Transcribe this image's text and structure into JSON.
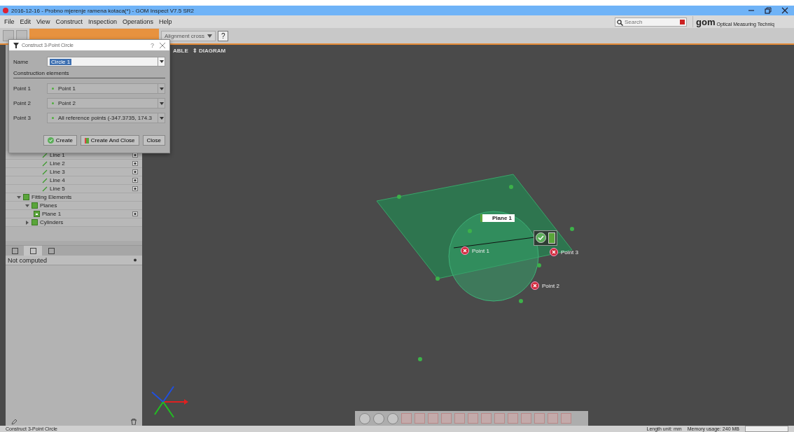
{
  "window": {
    "title": "2016-12-16 - Probno mjerenje ramena kotaca(*) - GOM Inspect V7.5 SR2"
  },
  "menu": [
    "File",
    "Edit",
    "View",
    "Construct",
    "Inspection",
    "Operations",
    "Help"
  ],
  "search": {
    "placeholder": "Search"
  },
  "logo": {
    "name": "gom",
    "tagline": "Optical Measuring Techniq"
  },
  "toolbar": {
    "alignment": "Alignment cross",
    "help": "?"
  },
  "view_tabs": [
    "ABLE",
    "⇕ DIAGRAM"
  ],
  "dialog": {
    "title": "Construct 3-Point Circle",
    "help": "?",
    "name_label": "Name",
    "name_value": "Circle 1",
    "section": "Construction elements",
    "points": [
      {
        "label": "Point 1",
        "value": "Point 1"
      },
      {
        "label": "Point 2",
        "value": "Point 2"
      },
      {
        "label": "Point 3",
        "value": "All reference points (-347.3735, 174.3"
      }
    ],
    "buttons": [
      {
        "kind": "create",
        "label": "Create"
      },
      {
        "kind": "create_close",
        "label": "Create And Close"
      },
      {
        "kind": "close",
        "label": "Close"
      }
    ]
  },
  "tree": [
    {
      "kind": "line",
      "label": "Line 1"
    },
    {
      "kind": "line",
      "label": "Line 2"
    },
    {
      "kind": "line",
      "label": "Line 3"
    },
    {
      "kind": "line",
      "label": "Line 4"
    },
    {
      "kind": "line",
      "label": "Line 5"
    },
    {
      "kind": "group",
      "label": "Fitting Elements",
      "expanded": true,
      "children": [
        {
          "kind": "group",
          "label": "Planes",
          "expanded": true,
          "children": [
            {
              "kind": "plane",
              "label": "Plane 1"
            }
          ]
        },
        {
          "kind": "group",
          "label": "Cylinders",
          "expanded": false
        }
      ]
    }
  ],
  "panel_tabs": [
    {
      "selected": false
    },
    {
      "selected": true
    },
    {
      "selected": false
    }
  ],
  "properties": {
    "value": "Not computed"
  },
  "canvas": {
    "plane_label": "Plane 1",
    "points": [
      {
        "label": "Point 1"
      },
      {
        "label": "Point 2"
      },
      {
        "label": "Point 3"
      }
    ]
  },
  "status_bar": {
    "left": "Construct 3-Point Circle",
    "unit": "Length unit: mm",
    "memory": "Memory usage: 240 MB"
  }
}
